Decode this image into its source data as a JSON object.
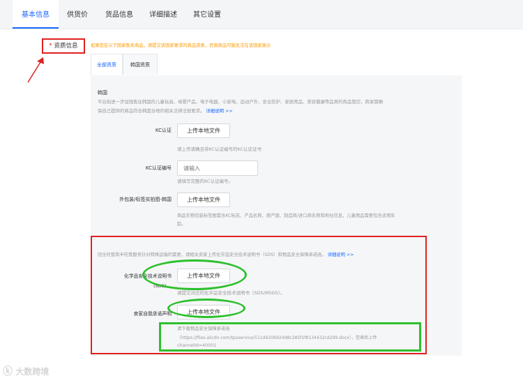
{
  "tabs": [
    "基本信息",
    "供货价",
    "货品信息",
    "详细描述",
    "其它设置"
  ],
  "qualification": {
    "required_mark": "*",
    "label": "资质信息",
    "warning": "如果您在以下国家售卖商品，请提交该国家要求的商品资质，否则商品可能无法在该国家展示"
  },
  "subtabs": [
    "全部资质",
    "韩国资质"
  ],
  "korea": {
    "heading": "韩国",
    "desc_line1": "平台拟进一步加强售往韩国的儿童玩具、母婴产品、电子电器、小家电、运动户外、安全防护、家居用品、美容健康等品类的商品管控，商家需确",
    "desc_line2": "保自己提供的商品符合韩国当地的相关法律法规要求。",
    "detail_link": "详细说明 >>",
    "kc_cert": {
      "label": "KC认证",
      "button": "上传本地文件",
      "hint": "请上传请确且带KC认证编号的KC认证证书"
    },
    "kc_number": {
      "label": "KC认证编号",
      "placeholder": "请输入",
      "hint": "请填写完整的KC认证编号。"
    },
    "package_photo": {
      "label": "外包装/标签实拍图-韩国",
      "button": "上传本地文件",
      "hint_line1": "商品实物包装标签图需含KC标志、产品名称、原产国、制造商/进口商名称和地址信息，儿童用品需要包含适用年",
      "hint_line2": "龄。"
    }
  },
  "safety": {
    "notice": "因全托管和半托管服务针对特殊运输的需要，请相关卖家上传化学品安全技术说明书（SDS）和物品安全保障承诺函。",
    "detail_link": "详细说明 >>",
    "sds": {
      "label": "化学品安全技术说明书",
      "label_sub": "(SDS)",
      "button": "上传本地文件",
      "hint": "请提交对应的化学品安全技术说明书（SDS/MSDS）。"
    },
    "commitment": {
      "label": "卖家自我承诺声明",
      "button": "上传本地文件",
      "hint_line1": "请下载物品安全保障承诺函",
      "hint_line2": "（https://files.alicdn.com/tpsservice/511d4206924d8c285f1f8134432cd299.docx），签章后上传",
      "hint_line3": "channelId=40001"
    }
  },
  "watermark": "大数跨境",
  "colors": {
    "accent": "#1a66ff",
    "warning": "#ff9900",
    "annotation_red": "#e02020",
    "annotation_green": "#2dc02d"
  }
}
